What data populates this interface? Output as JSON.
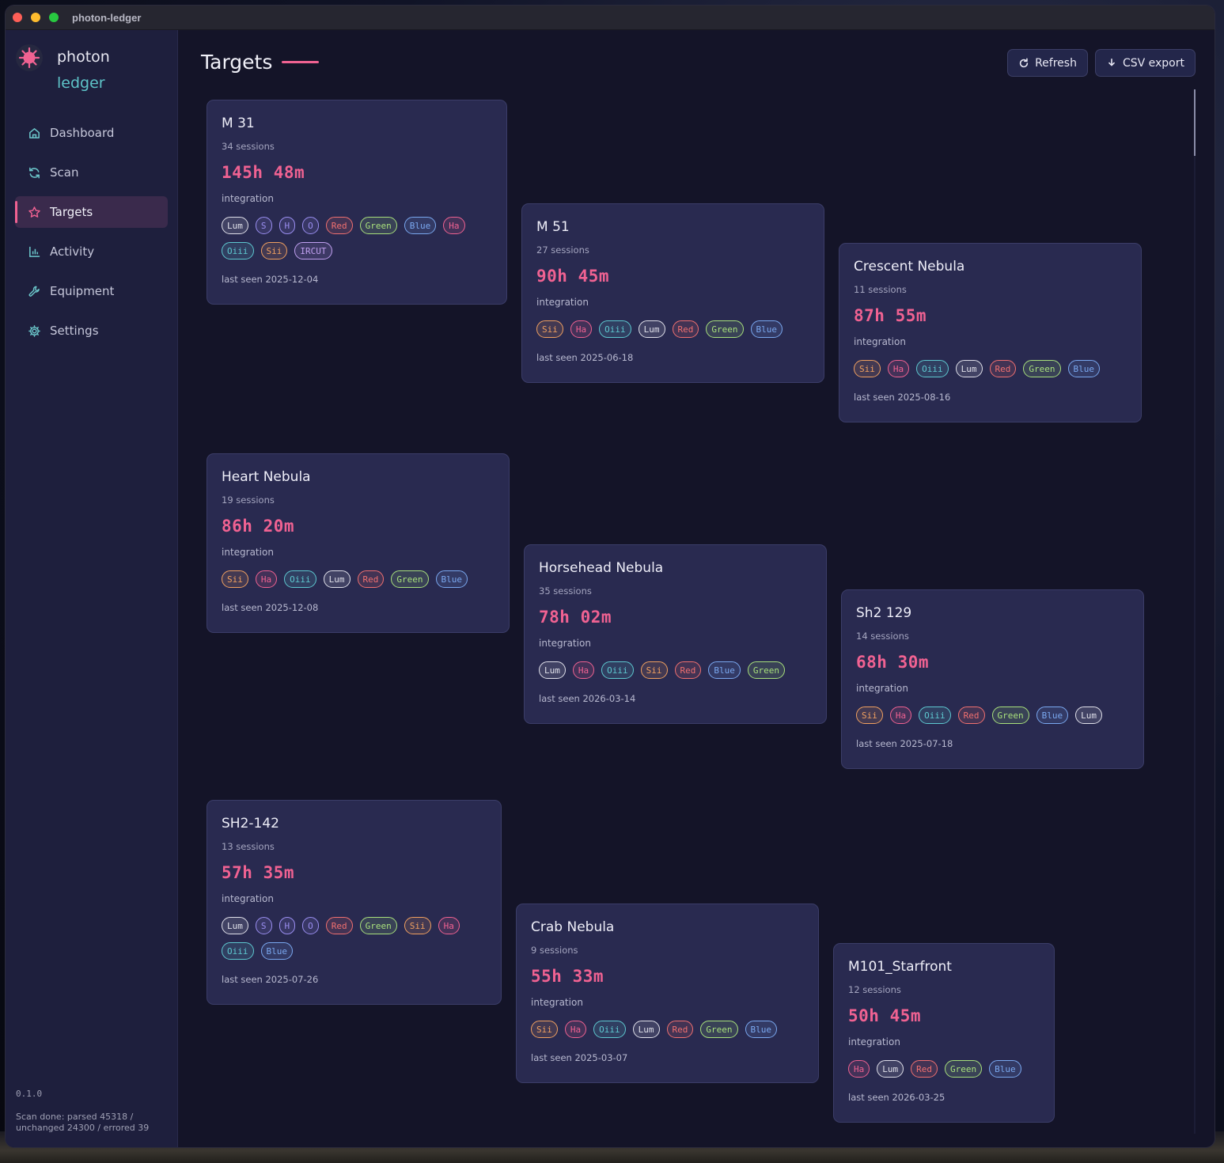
{
  "window": {
    "title": "photon-ledger"
  },
  "brand": {
    "line1": "photon",
    "line2": "ledger"
  },
  "nav": [
    {
      "label": "Dashboard",
      "icon": "home-icon"
    },
    {
      "label": "Scan",
      "icon": "refresh-icon"
    },
    {
      "label": "Targets",
      "icon": "star-icon",
      "active": true
    },
    {
      "label": "Activity",
      "icon": "bar-chart-icon"
    },
    {
      "label": "Equipment",
      "icon": "wrench-icon"
    },
    {
      "label": "Settings",
      "icon": "gear-icon"
    }
  ],
  "version": "0.1.0",
  "scan_status": "Scan done: parsed 45318 / unchanged 24300 / errored 39",
  "page": {
    "title": "Targets"
  },
  "toolbar": {
    "refresh_label": "Refresh",
    "export_label": "CSV export"
  },
  "filter_colors": {
    "Lum": "#e0e0ea",
    "S": "#9a8ef0",
    "H": "#9a8ef0",
    "O": "#9a8ef0",
    "Red": "#f07070",
    "Green": "#a8e07c",
    "Blue": "#7aa8f0",
    "Ha": "#f06292",
    "Oiii": "#5ec8d0",
    "Sii": "#f0a060",
    "IRCUT": "#c0a0f0"
  },
  "duration_label": "integration",
  "cards": [
    {
      "name": "M 31",
      "sessions": "34 sessions",
      "duration": "145h 48m",
      "filters": [
        "Lum",
        "S",
        "H",
        "O",
        "Red",
        "Green",
        "Blue",
        "Ha",
        "Oiii",
        "Sii",
        "IRCUT"
      ],
      "last_seen": "last seen 2025-12-04"
    },
    {
      "name": "M 51",
      "sessions": "27 sessions",
      "duration": "90h 45m",
      "filters": [
        "Sii",
        "Ha",
        "Oiii",
        "Lum",
        "Red",
        "Green",
        "Blue"
      ],
      "last_seen": "last seen 2025-06-18"
    },
    {
      "name": "Crescent Nebula",
      "sessions": "11 sessions",
      "duration": "87h 55m",
      "filters": [
        "Sii",
        "Ha",
        "Oiii",
        "Lum",
        "Red",
        "Green",
        "Blue"
      ],
      "last_seen": "last seen 2025-08-16"
    },
    {
      "name": "Heart Nebula",
      "sessions": "19 sessions",
      "duration": "86h 20m",
      "filters": [
        "Sii",
        "Ha",
        "Oiii",
        "Lum",
        "Red",
        "Green",
        "Blue"
      ],
      "last_seen": "last seen 2025-12-08"
    },
    {
      "name": "Horsehead Nebula",
      "sessions": "35 sessions",
      "duration": "78h 02m",
      "filters": [
        "Lum",
        "Ha",
        "Oiii",
        "Sii",
        "Red",
        "Blue",
        "Green"
      ],
      "last_seen": "last seen 2026-03-14"
    },
    {
      "name": "Sh2 129",
      "sessions": "14 sessions",
      "duration": "68h 30m",
      "filters": [
        "Sii",
        "Ha",
        "Oiii",
        "Red",
        "Green",
        "Blue",
        "Lum"
      ],
      "last_seen": "last seen 2025-07-18"
    },
    {
      "name": "SH2-142",
      "sessions": "13 sessions",
      "duration": "57h 35m",
      "filters": [
        "Lum",
        "S",
        "H",
        "O",
        "Red",
        "Green",
        "Sii",
        "Ha",
        "Oiii",
        "Blue"
      ],
      "last_seen": "last seen 2025-07-26"
    },
    {
      "name": "Crab Nebula",
      "sessions": "9 sessions",
      "duration": "55h 33m",
      "filters": [
        "Sii",
        "Ha",
        "Oiii",
        "Lum",
        "Red",
        "Green",
        "Blue"
      ],
      "last_seen": "last seen 2025-03-07"
    },
    {
      "name": "M101_Starfront",
      "sessions": "12 sessions",
      "duration": "50h 45m",
      "filters": [
        "Ha",
        "Lum",
        "Red",
        "Green",
        "Blue"
      ],
      "last_seen": "last seen 2026-03-25"
    }
  ]
}
